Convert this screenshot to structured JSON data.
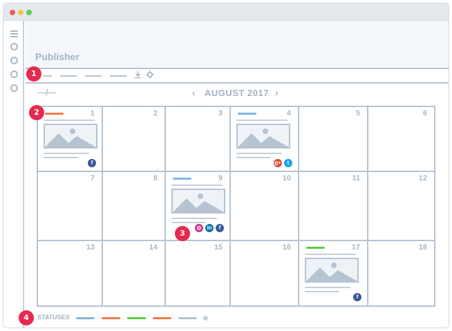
{
  "app": {
    "title": "Publisher"
  },
  "callouts": {
    "one": "1",
    "two": "2",
    "three": "3",
    "four": "4"
  },
  "toolbar": {
    "view_toggle": "—/—",
    "download_icon": "download-icon",
    "settings_icon": "gear-icon"
  },
  "calendar": {
    "month_label": "AUGUST 2017",
    "prev_icon": "‹",
    "next_icon": "›",
    "days": [
      "1",
      "2",
      "3",
      "4",
      "5",
      "6",
      "7",
      "8",
      "9",
      "10",
      "11",
      "12",
      "13",
      "14",
      "15",
      "16",
      "17",
      "18"
    ]
  },
  "posts": [
    {
      "day": "1",
      "status_color": "#f07c4b",
      "networks": [
        "facebook"
      ]
    },
    {
      "day": "4",
      "status_color": "#7fb6e2",
      "networks": [
        "google-plus",
        "twitter"
      ]
    },
    {
      "day": "9",
      "status_color": "#7fb6e2",
      "networks": [
        "instagram",
        "linkedin",
        "facebook"
      ]
    },
    {
      "day": "17",
      "status_color": "#5fcb3b",
      "networks": [
        "facebook"
      ]
    }
  ],
  "social_glyphs": {
    "facebook": "f",
    "twitter": "t",
    "google-plus": "g+",
    "instagram": "◎",
    "linkedin": "in"
  },
  "statuses": {
    "label": "STATUSES",
    "colors": [
      "#7fb6e2",
      "#f07c4b",
      "#5fcb3b",
      "#f07c4b",
      "#b6c3d1"
    ]
  },
  "colors": {
    "facebook": "#3b5998",
    "twitter": "#1da1f2",
    "google-plus": "#dd4b39",
    "instagram": "#c13584",
    "linkedin": "#0e76a8",
    "callout": "#e6294f"
  }
}
